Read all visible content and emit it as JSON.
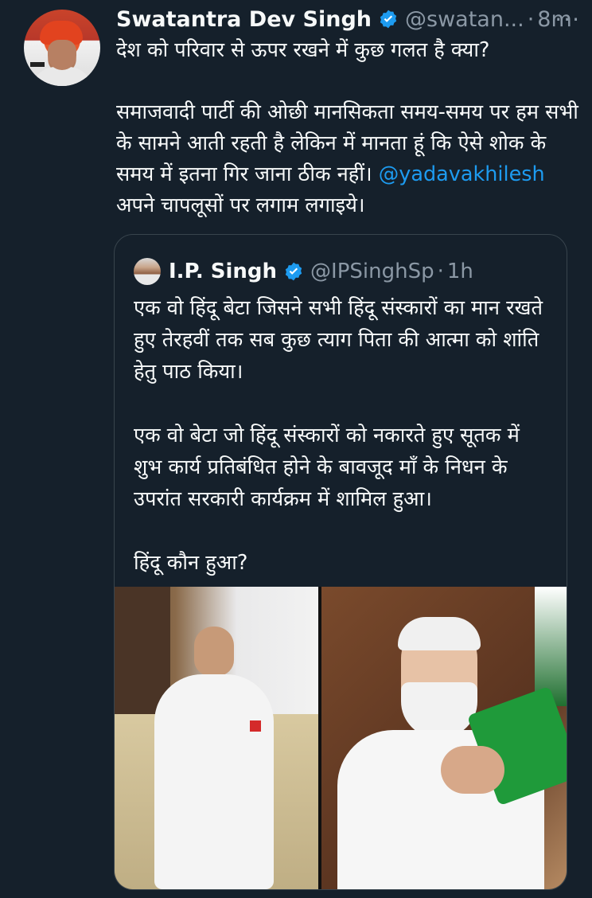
{
  "tweet": {
    "author_name": "Swatantra Dev Singh",
    "author_handle": "@swatan...",
    "separator": "·",
    "time": "8m",
    "more_glyph": "···",
    "paragraphs": [
      "देश को परिवार से ऊपर रखने में कुछ गलत है क्या?",
      "समाजवादी पार्टी की ओछी मानसिकता समय-समय पर हम सभी के सामने आती रहती है लेकिन में मानता हूं कि ऐसे शोक के समय में इतना गिर जाना ठीक नहीं।"
    ],
    "mention": "@yadavakhilesh",
    "mention_suffix": " अपने चापलूसों पर लगाम लगाइये।"
  },
  "quote": {
    "author_name": "I.P. Singh",
    "author_handle": "@IPSinghSp",
    "separator": "·",
    "time": "1h",
    "paragraphs": [
      "एक वो हिंदू बेटा जिसने सभी हिंदू संस्कारों का मान रखते हुए तेरहवीं तक सब कुछ त्याग पिता की आत्मा को शांति हेतु पाठ किया।",
      "एक वो बेटा जो हिंदू संस्कारों को नकारते हुए सूतक में शुभ कार्य प्रतिबंधित होने के बावजूद माँ के निधन के उपरांत सरकारी कार्यक्रम में शामिल हुआ।",
      "हिंदू कौन हुआ?"
    ]
  },
  "colors": {
    "background": "#15202b",
    "text": "#f7f9f9",
    "muted": "#8b98a5",
    "link": "#1d9bf0",
    "border": "#38444d",
    "verified": "#1d9bf0"
  }
}
